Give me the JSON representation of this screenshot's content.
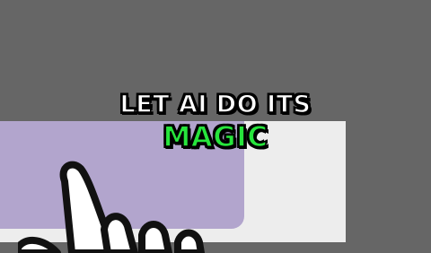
{
  "caption": {
    "line1": "LET AI DO ITS",
    "line2": "MAGIC"
  },
  "icons": {
    "cursor": "hand-pointer-icon"
  },
  "colors": {
    "background": "#666666",
    "screen": "#ededed",
    "panel": "#b2a5cd",
    "caption_primary": "#ffffff",
    "caption_accent": "#27e53c"
  }
}
